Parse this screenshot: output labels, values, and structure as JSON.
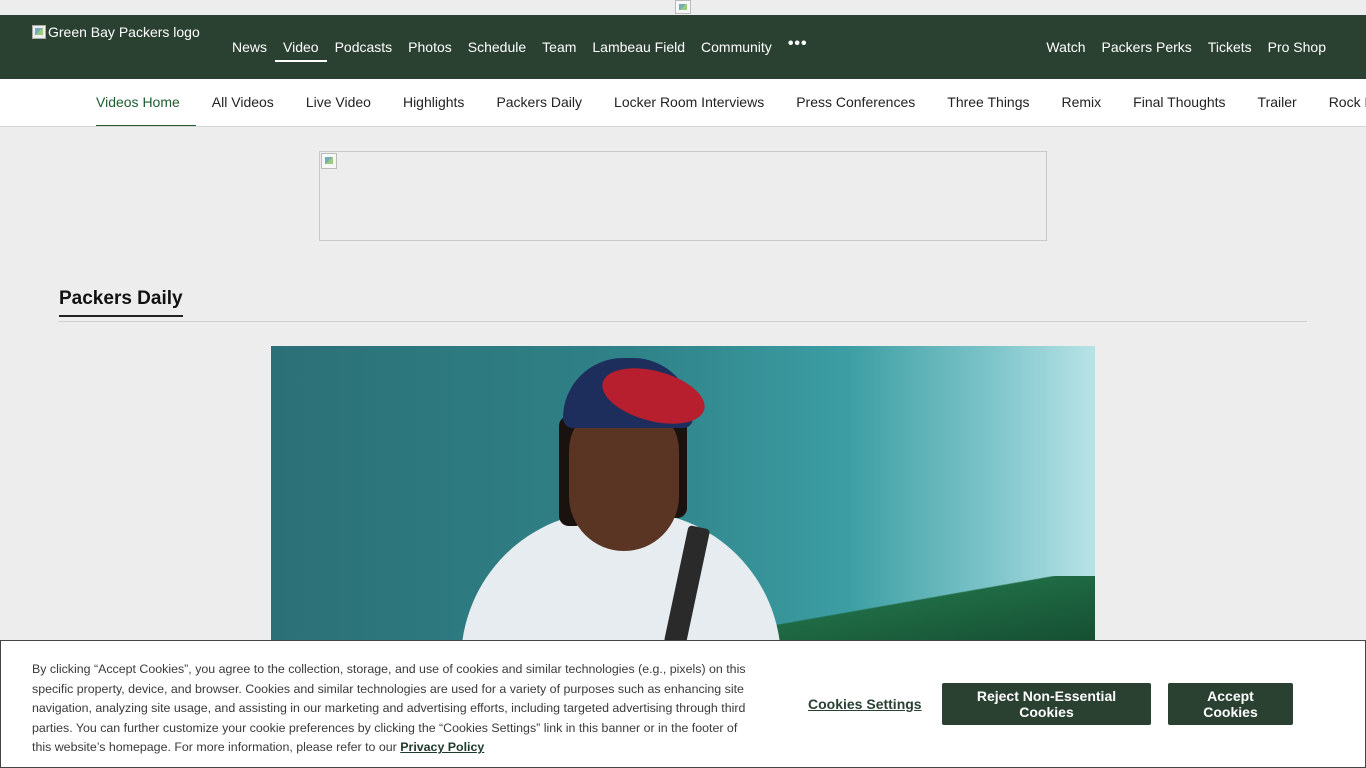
{
  "top_image_alt": "",
  "logo": {
    "alt": "Green Bay Packers logo"
  },
  "main_nav": {
    "left": [
      "News",
      "Video",
      "Podcasts",
      "Photos",
      "Schedule",
      "Team",
      "Lambeau Field",
      "Community"
    ],
    "active": "Video",
    "more": "•••",
    "right": [
      "Watch",
      "Packers Perks",
      "Tickets",
      "Pro Shop"
    ]
  },
  "sub_nav": {
    "items": [
      "Videos Home",
      "All Videos",
      "Live Video",
      "Highlights",
      "Packers Daily",
      "Locker Room Interviews",
      "Press Conferences",
      "Three Things",
      "Remix",
      "Final Thoughts",
      "Trailer",
      "Rock Report"
    ],
    "active": "Videos Home"
  },
  "section": {
    "title": "Packers Daily"
  },
  "cookie": {
    "text": "By clicking “Accept Cookies”, you agree to the collection, storage, and use of cookies and similar technologies (e.g., pixels) on this specific property, device, and browser. Cookies and similar technologies are used for a variety of purposes such as enhancing site navigation, analyzing site usage, and assisting in our marketing and advertising efforts, including targeted advertising through third parties. You can further customize your cookie preferences by clicking the “Cookies Settings” link in this banner or in the footer of this website’s homepage. For more information, please refer to our",
    "privacy_link": "Privacy Policy",
    "settings_label": "Cookies Settings",
    "reject_label": "Reject Non-Essential Cookies",
    "accept_label": "Accept Cookies"
  },
  "colors": {
    "brand_green": "#2a4132",
    "accent_green": "#1e5b2f",
    "background": "#ededed"
  }
}
